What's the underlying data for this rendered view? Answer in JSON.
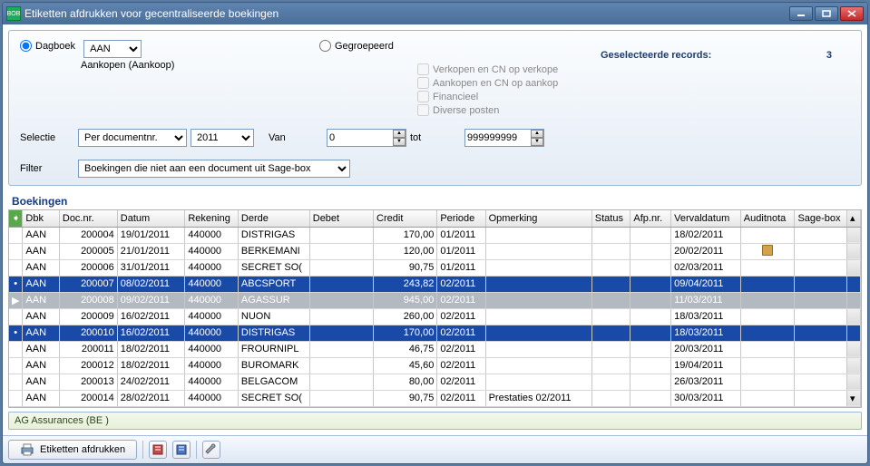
{
  "window": {
    "title": "Etiketten afdrukken voor gecentraliseerde boekingen"
  },
  "options": {
    "dagboek_label": "Dagboek",
    "dagboek_value": "AAN",
    "dagboek_sub": "Aankopen (Aankoop)",
    "gegroepeerd_label": "Gegroepeerd",
    "checks": [
      "Verkopen en CN op verkope",
      "Aankopen en CN op aankop",
      "Financieel",
      "Diverse posten"
    ],
    "selected_label": "Geselecteerde records:",
    "selected_count": "3"
  },
  "selectie": {
    "label": "Selectie",
    "per_value": "Per documentnr.",
    "year_value": "2011",
    "van_label": "Van",
    "van_value": "0",
    "tot_label": "tot",
    "tot_value": "999999999"
  },
  "filter": {
    "label": "Filter",
    "value": "Boekingen die niet aan een document uit Sage-box"
  },
  "grid": {
    "title": "Boekingen",
    "headers": [
      "Dbk",
      "Doc.nr.",
      "Datum",
      "Rekening",
      "Derde",
      "Debet",
      "Credit",
      "Periode",
      "Opmerking",
      "Status",
      "Afp.nr.",
      "Vervaldatum",
      "Auditnota",
      "Sage-box"
    ],
    "rows": [
      {
        "mark": "",
        "dbk": "AAN",
        "doc": "200004",
        "datum": "19/01/2011",
        "rek": "440000",
        "derde": "DISTRIGAS",
        "debet": "",
        "credit": "170,00",
        "periode": "01/2011",
        "opm": "",
        "status": "",
        "afp": "",
        "verval": "18/02/2011",
        "audit": "",
        "sb": "",
        "sel": ""
      },
      {
        "mark": "",
        "dbk": "AAN",
        "doc": "200005",
        "datum": "21/01/2011",
        "rek": "440000",
        "derde": "BERKEMANI",
        "debet": "",
        "credit": "120,00",
        "periode": "01/2011",
        "opm": "",
        "status": "",
        "afp": "",
        "verval": "20/02/2011",
        "audit": "note",
        "sb": "",
        "sel": ""
      },
      {
        "mark": "",
        "dbk": "AAN",
        "doc": "200006",
        "datum": "31/01/2011",
        "rek": "440000",
        "derde": "SECRET SO(",
        "debet": "",
        "credit": "90,75",
        "periode": "01/2011",
        "opm": "",
        "status": "",
        "afp": "",
        "verval": "02/03/2011",
        "audit": "",
        "sb": "",
        "sel": ""
      },
      {
        "mark": "•",
        "dbk": "AAN",
        "doc": "200007",
        "datum": "08/02/2011",
        "rek": "440000",
        "derde": "ABCSPORT",
        "debet": "",
        "credit": "243,82",
        "periode": "02/2011",
        "opm": "",
        "status": "",
        "afp": "",
        "verval": "09/04/2011",
        "audit": "",
        "sb": "",
        "sel": "sel"
      },
      {
        "mark": "▶",
        "dbk": "AAN",
        "doc": "200008",
        "datum": "09/02/2011",
        "rek": "440000",
        "derde": "AGASSUR",
        "debet": "",
        "credit": "945,00",
        "periode": "02/2011",
        "opm": "",
        "status": "",
        "afp": "",
        "verval": "11/03/2011",
        "audit": "",
        "sb": "",
        "sel": "sel-gray"
      },
      {
        "mark": "",
        "dbk": "AAN",
        "doc": "200009",
        "datum": "16/02/2011",
        "rek": "440000",
        "derde": "NUON",
        "debet": "",
        "credit": "260,00",
        "periode": "02/2011",
        "opm": "",
        "status": "",
        "afp": "",
        "verval": "18/03/2011",
        "audit": "",
        "sb": "",
        "sel": ""
      },
      {
        "mark": "•",
        "dbk": "AAN",
        "doc": "200010",
        "datum": "16/02/2011",
        "rek": "440000",
        "derde": "DISTRIGAS",
        "debet": "",
        "credit": "170,00",
        "periode": "02/2011",
        "opm": "",
        "status": "",
        "afp": "",
        "verval": "18/03/2011",
        "audit": "",
        "sb": "",
        "sel": "sel"
      },
      {
        "mark": "",
        "dbk": "AAN",
        "doc": "200011",
        "datum": "18/02/2011",
        "rek": "440000",
        "derde": "FROURNIPL",
        "debet": "",
        "credit": "46,75",
        "periode": "02/2011",
        "opm": "",
        "status": "",
        "afp": "",
        "verval": "20/03/2011",
        "audit": "",
        "sb": "",
        "sel": ""
      },
      {
        "mark": "",
        "dbk": "AAN",
        "doc": "200012",
        "datum": "18/02/2011",
        "rek": "440000",
        "derde": "BUROMARK",
        "debet": "",
        "credit": "45,60",
        "periode": "02/2011",
        "opm": "",
        "status": "",
        "afp": "",
        "verval": "19/04/2011",
        "audit": "",
        "sb": "",
        "sel": ""
      },
      {
        "mark": "",
        "dbk": "AAN",
        "doc": "200013",
        "datum": "24/02/2011",
        "rek": "440000",
        "derde": "BELGACOM",
        "debet": "",
        "credit": "80,00",
        "periode": "02/2011",
        "opm": "",
        "status": "",
        "afp": "",
        "verval": "26/03/2011",
        "audit": "",
        "sb": "",
        "sel": ""
      },
      {
        "mark": "",
        "dbk": "AAN",
        "doc": "200014",
        "datum": "28/02/2011",
        "rek": "440000",
        "derde": "SECRET SO(",
        "debet": "",
        "credit": "90,75",
        "periode": "02/2011",
        "opm": "Prestaties 02/2011",
        "status": "",
        "afp": "",
        "verval": "30/03/2011",
        "audit": "",
        "sb": "",
        "sel": ""
      }
    ]
  },
  "footer_info": "AG Assurances (BE )",
  "toolbar": {
    "print_label": "Etiketten afdrukken"
  },
  "icons": {
    "minimize": "min",
    "maximize": "max",
    "close": "x",
    "printer": "printer",
    "red_book": "rb",
    "blue_book": "bb",
    "wrench": "wr"
  }
}
